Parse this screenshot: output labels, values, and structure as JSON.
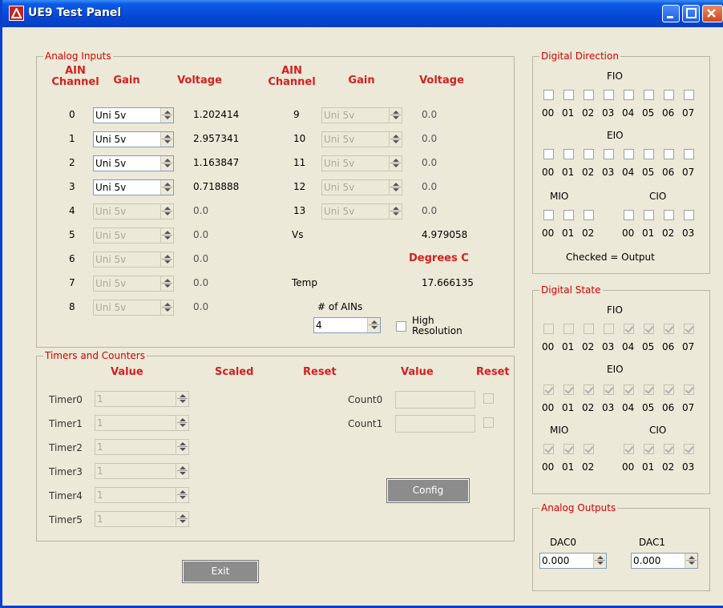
{
  "window": {
    "title": "UE9 Test Panel"
  },
  "analog_inputs": {
    "title": "Analog Inputs",
    "headers": {
      "channel": "AIN\nChannel",
      "gain": "Gain",
      "voltage": "Voltage"
    },
    "left_rows": [
      {
        "ch": "0",
        "gain": "Uni 5v",
        "enabled": true,
        "voltage": "1.202414"
      },
      {
        "ch": "1",
        "gain": "Uni 5v",
        "enabled": true,
        "voltage": "2.957341"
      },
      {
        "ch": "2",
        "gain": "Uni 5v",
        "enabled": true,
        "voltage": "1.163847"
      },
      {
        "ch": "3",
        "gain": "Uni 5v",
        "enabled": true,
        "voltage": "0.718888"
      },
      {
        "ch": "4",
        "gain": "Uni 5v",
        "enabled": false,
        "voltage": "0.0"
      },
      {
        "ch": "5",
        "gain": "Uni 5v",
        "enabled": false,
        "voltage": "0.0"
      },
      {
        "ch": "6",
        "gain": "Uni 5v",
        "enabled": false,
        "voltage": "0.0"
      },
      {
        "ch": "7",
        "gain": "Uni 5v",
        "enabled": false,
        "voltage": "0.0"
      },
      {
        "ch": "8",
        "gain": "Uni 5v",
        "enabled": false,
        "voltage": "0.0"
      }
    ],
    "right_rows": [
      {
        "ch": "9",
        "gain": "Uni 5v",
        "voltage": "0.0"
      },
      {
        "ch": "10",
        "gain": "Uni 5v",
        "voltage": "0.0"
      },
      {
        "ch": "11",
        "gain": "Uni 5v",
        "voltage": "0.0"
      },
      {
        "ch": "12",
        "gain": "Uni 5v",
        "voltage": "0.0"
      },
      {
        "ch": "13",
        "gain": "Uni 5v",
        "voltage": "0.0"
      }
    ],
    "vs_label": "Vs",
    "vs_value": "4.979058",
    "degrees_label": "Degrees C",
    "temp_label": "Temp",
    "temp_value": "17.666135",
    "num_ains_label": "# of AINs",
    "num_ains_value": "4",
    "high_res_label": "High\nResolution",
    "high_res_checked": false
  },
  "timers_counters": {
    "title": "Timers and Counters",
    "headers": {
      "value": "Value",
      "scaled": "Scaled",
      "reset": "Reset",
      "value2": "Value",
      "reset2": "Reset"
    },
    "timers": [
      {
        "label": "Timer0",
        "value": "1"
      },
      {
        "label": "Timer1",
        "value": "1"
      },
      {
        "label": "Timer2",
        "value": "1"
      },
      {
        "label": "Timer3",
        "value": "1"
      },
      {
        "label": "Timer4",
        "value": "1"
      },
      {
        "label": "Timer5",
        "value": "1"
      }
    ],
    "counters": [
      {
        "label": "Count0",
        "value": ""
      },
      {
        "label": "Count1",
        "value": ""
      }
    ],
    "config_label": "Config"
  },
  "exit_label": "Exit",
  "digital_direction": {
    "title": "Digital Direction",
    "fio_label": "FIO",
    "eio_label": "EIO",
    "mio_label": "MIO",
    "cio_label": "CIO",
    "bits8": [
      "00",
      "01",
      "02",
      "03",
      "04",
      "05",
      "06",
      "07"
    ],
    "bits3": [
      "00",
      "01",
      "02"
    ],
    "bits4": [
      "00",
      "01",
      "02",
      "03"
    ],
    "note": "Checked = Output"
  },
  "digital_state": {
    "title": "Digital State",
    "fio_label": "FIO",
    "eio_label": "EIO",
    "mio_label": "MIO",
    "cio_label": "CIO",
    "fio_checked": [
      false,
      false,
      false,
      false,
      true,
      true,
      true,
      true
    ],
    "eio_checked": [
      true,
      true,
      true,
      true,
      true,
      true,
      true,
      true
    ],
    "mio_checked": [
      true,
      true,
      true
    ],
    "cio_checked": [
      true,
      true,
      true,
      true
    ]
  },
  "analog_outputs": {
    "title": "Analog Outputs",
    "dac0_label": "DAC0",
    "dac0_value": "0.000",
    "dac1_label": "DAC1",
    "dac1_value": "0.000"
  }
}
